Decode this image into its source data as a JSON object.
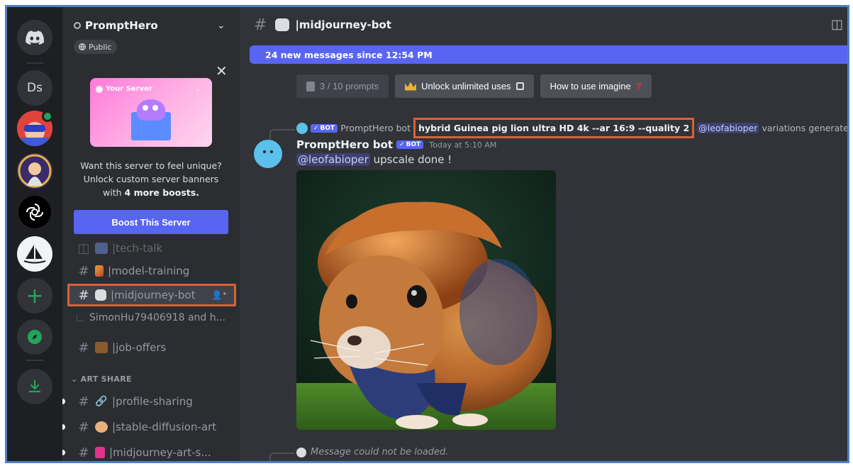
{
  "server": {
    "name": "PromptHero",
    "visibility": "Public",
    "promo_banner_label": "Your Server",
    "promo_text_1": "Want this server to feel unique?",
    "promo_text_2": "Unlock custom server banners",
    "promo_text_3_prefix": "with ",
    "promo_text_3_bold": "4 more boosts.",
    "boost_button": "Boost This Server"
  },
  "rail": {
    "ds_label": "Ds"
  },
  "channels": {
    "tech": "tech-talk",
    "model": "model-training",
    "mj": "midjourney-bot",
    "thread": "SimonHu79406918 and h...",
    "jobs": "job-offers",
    "category": "ART SHARE",
    "profile": "profile-sharing",
    "sd": "stable-diffusion-art",
    "mjart": "midjourney-art-s..."
  },
  "chat": {
    "channel_title": "midjourney-bot",
    "new_messages": "24 new messages since 12:54 PM",
    "buttons": {
      "prompts": "3 / 10 prompts",
      "unlock": "Unlock unlimited uses",
      "howto": "How to use imagine"
    },
    "reply": {
      "author": "PromptHero bot",
      "prompt": "hybrid Guinea pig lion ultra HD 4k --ar 16:9 --quality 2",
      "mention": "@leofabioper",
      "suffix": "variations generated !"
    },
    "message": {
      "author": "PromptHero bot",
      "bot_tag": "BOT",
      "timestamp": "Today at 5:10 AM",
      "mention": "@leofabioper",
      "text": "upscale done !"
    },
    "system_msg": "Message could not be loaded."
  },
  "colors": {
    "accent": "#5865f2",
    "highlight_border": "#d9623b",
    "frame_border": "#4e7fc0"
  }
}
